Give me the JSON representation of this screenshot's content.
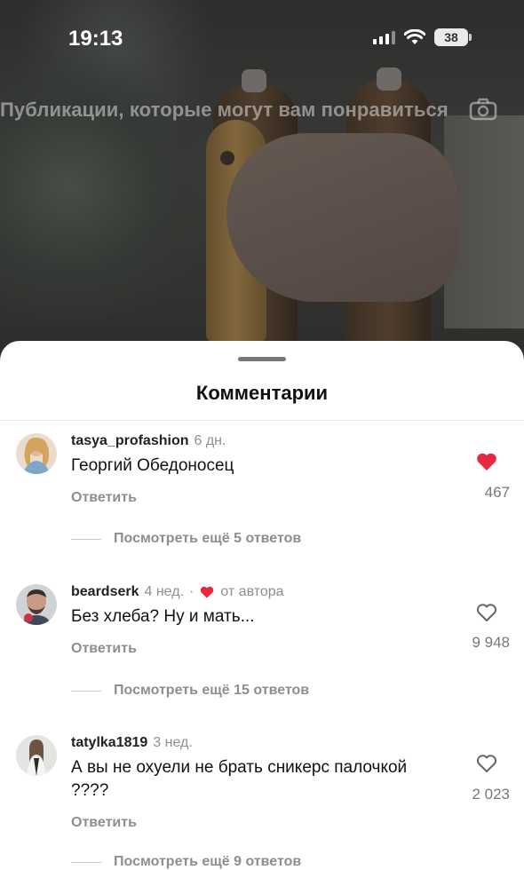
{
  "status_bar": {
    "time": "19:13",
    "battery": "38"
  },
  "overlay_title": "Публикации, которые могут вам понравиться",
  "sheet": {
    "title": "Комментарии"
  },
  "comments": [
    {
      "user": "tasya_profashion",
      "age": "6 дн.",
      "text": "Георгий Обедоносец",
      "reply": "Ответить",
      "likes": "467",
      "liked": true,
      "more": "Посмотреть ещё 5 ответов"
    },
    {
      "user": "beardserk",
      "age": "4 нед.",
      "separator": "·",
      "author_like": "от автора",
      "text": "Без хлеба? Ну и мать...",
      "reply": "Ответить",
      "likes": "9 948",
      "liked": false,
      "more": "Посмотреть ещё 15 ответов"
    },
    {
      "user": "tatylka1819",
      "age": "3 нед.",
      "text": "А вы не охуели не брать сникерс палочкой ????",
      "reply": "Ответить",
      "likes": "2 023",
      "liked": false,
      "more": "Посмотреть ещё 9 ответов"
    }
  ],
  "colors": {
    "heart": "#e8283e",
    "muted": "#8e8e8e"
  },
  "icons": [
    "signal-icon",
    "wifi-icon",
    "battery-icon",
    "camera-icon",
    "heart-icon",
    "heart-outline-icon"
  ]
}
